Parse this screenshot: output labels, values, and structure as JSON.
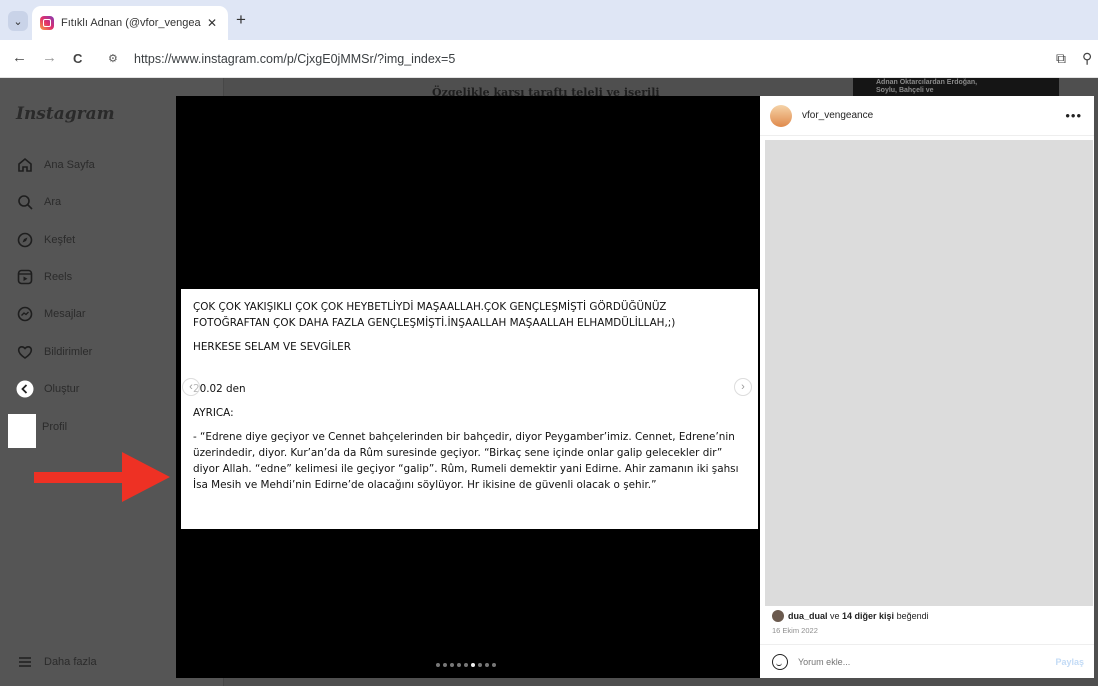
{
  "browser": {
    "tab_title": "Fıtıklı Adnan (@vfor_vengeanc",
    "tab_close": "✕",
    "new_tab": "+",
    "url": "https://www.instagram.com/p/CjxgE0jMMSr/?img_index=5",
    "back": "←",
    "forward": "→",
    "reload": "C",
    "dropdown": "⌄"
  },
  "sidebar": {
    "logo": "Instagram",
    "items": [
      {
        "label": "Ana Sayfa",
        "icon": "home-icon"
      },
      {
        "label": "Ara",
        "icon": "search-icon"
      },
      {
        "label": "Keşfet",
        "icon": "compass-icon"
      },
      {
        "label": "Reels",
        "icon": "reels-icon"
      },
      {
        "label": "Mesajlar",
        "icon": "messenger-icon"
      },
      {
        "label": "Bildirimler",
        "icon": "heart-icon"
      },
      {
        "label": "Oluştur",
        "icon": "create-icon"
      },
      {
        "label": "Profil",
        "icon": "profile-icon"
      }
    ],
    "more": "Daha fazla"
  },
  "background": {
    "headline": "Özgelikle karşı taraftı teleli ve işerili",
    "thumb_text": "Adnan Oktarcılardan Erdoğan, Soylu, Bahçeli ve"
  },
  "slide": {
    "line1": "ÇOK ÇOK YAKIŞIKLI ÇOK ÇOK HEYBETLİYDİ MAŞAALLAH.ÇOK GENÇLEŞMİŞTİ GÖRDÜĞÜNÜZ FOTOĞRAFTAN ÇOK DAHA FAZLA GENÇLEŞMİŞTİ.İNŞAALLAH MAŞAALLAH ELHAMDÜLİLLAH,;)",
    "line2": "HERKESE SELAM VE SEVGİLER",
    "line3": "20.02 den",
    "line4": "AYRICA:",
    "quote": "-          “Edrene diye geçiyor ve Cennet bahçelerinden bir bahçedir, diyor Peygamber’imiz. Cennet, Edrene’nin üzerindedir, diyor. Kur’an’da da Rûm suresinde geçiyor. “Birkaç sene içinde onlar galip gelecekler dir” diyor Allah. “edne” kelimesi ile geçiyor “galip”. Rûm, Rumeli demektir yani Edirne. Ahir zamanın iki şahsı İsa Mesih ve Mehdi’nin Edirne’de olacağını söylüyor. Hr ikisine de güvenli olacak o şehir.”"
  },
  "carousel": {
    "prev": "‹",
    "next": "›",
    "dot_count": 9,
    "active_dot": 5
  },
  "panel": {
    "username": "vfor_vengeance",
    "more": "•••",
    "likes_user": "dua_dual",
    "likes_mid": " ve ",
    "likes_others": "14 diğer kişi",
    "likes_end": " beğendi",
    "date": "16 Ekim 2022",
    "comment_placeholder": "Yorum ekle...",
    "post_button": "Paylaş"
  },
  "colors": {
    "arrow": "#ee3124",
    "post_button": "#c3dbf6"
  }
}
